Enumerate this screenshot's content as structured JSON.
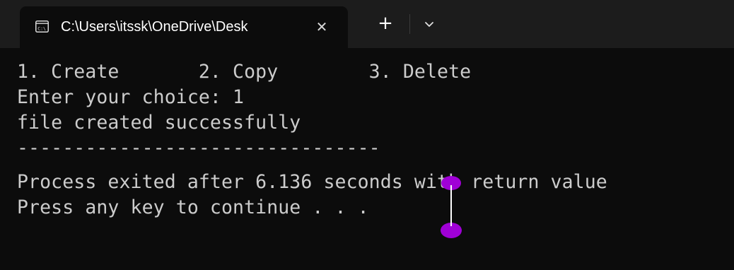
{
  "window": {
    "tab_title": "C:\\Users\\itssk\\OneDrive\\Desk",
    "close_glyph": "✕",
    "new_tab_glyph": "+",
    "tab_icon": "console-icon",
    "dropdown_icon": "chevron-down-icon"
  },
  "terminal": {
    "lines": [
      "1. Create       2. Copy        3. Delete",
      "Enter your choice: 1",
      "file created successfully",
      "--------------------------------",
      "Process exited after 6.136 seconds with return value",
      "Press any key to continue . . ."
    ]
  },
  "colors": {
    "terminal_bg": "#0c0c0c",
    "titlebar_bg": "#1c1c1c",
    "text": "#cccccc",
    "cursor_accent": "#a000d6"
  }
}
